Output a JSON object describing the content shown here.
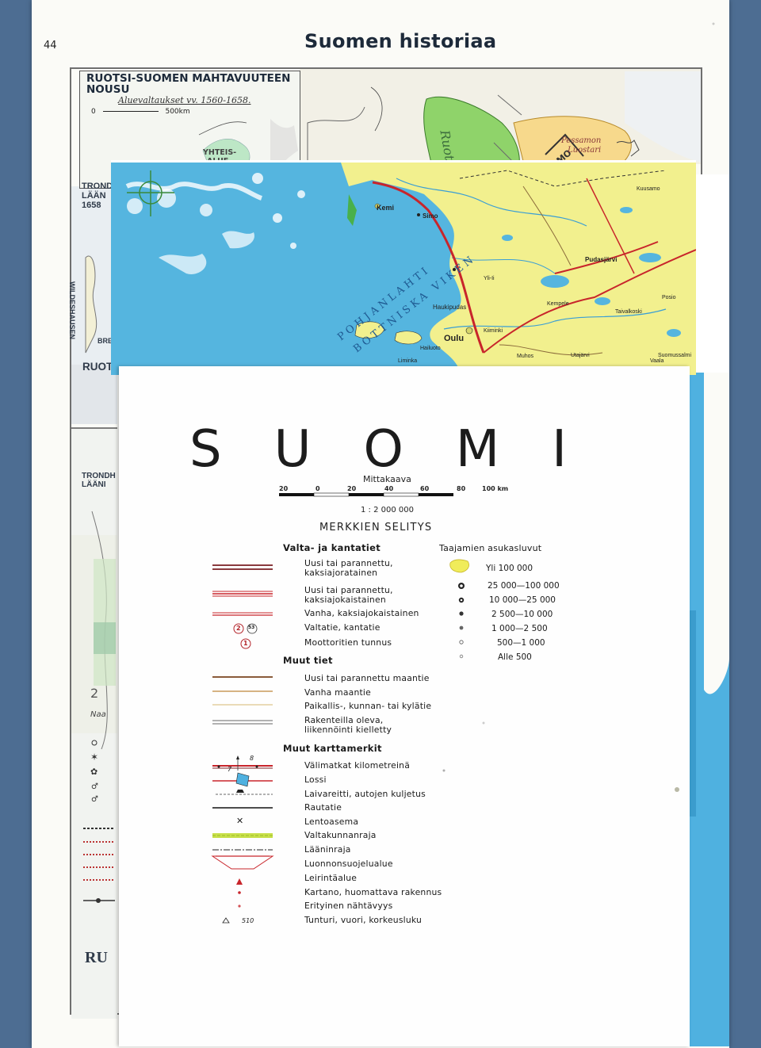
{
  "book_page": {
    "page_number": "44",
    "title": "Suomen historiaa"
  },
  "inset_map": {
    "title": "RUOTSI-SUOMEN MAHTAVUUTEEN NOUSU",
    "subtitle": "Aluevaltaukset vv. 1560-1658.",
    "scale_start": "0",
    "scale_end": "500km",
    "labels": [
      "YHTEIS-ALUE",
      "TRONDHJ LÄÄN 1658",
      "WILDESHAUSEN",
      "BREM",
      "RUOTS",
      "TRONDH LÄÄNI",
      "Pessamon Luostari",
      "RU"
    ]
  },
  "fold_map": {
    "sea_labels": [
      "POHJANLAHTI",
      "BOTTNISKA VIKEN"
    ],
    "places": [
      "Kemi",
      "Simo",
      "Ii",
      "Oulu",
      "Haukipudas",
      "Kiiminki",
      "Muhos",
      "Pudasjärvi",
      "Taivalkoski",
      "Posio",
      "Kuusamo",
      "Suomussalmi",
      "Hailuoto",
      "Liminka",
      "Kempele",
      "Yli-Ii",
      "Utajärvi",
      "Vaala"
    ]
  },
  "legend": {
    "map_title": "SUOMI",
    "scale_label": "Mittakaava",
    "scale_ticks": [
      "20",
      "0",
      "20",
      "40",
      "60",
      "80",
      "100 km"
    ],
    "ratio": "1 : 2 000 000",
    "heading": "MERKKIEN SELITYS",
    "section_roads": "Valta- ja kantatiet",
    "road_items": [
      "Uusi tai parannettu, kaksiajoratainen",
      "Uusi tai parannettu, kaksiajokaistainen",
      "Vanha, kaksiajokaistainen",
      "Valtatie, kantatie",
      "Moottoritien tunnus"
    ],
    "road_badges": [
      "2",
      "53",
      "1"
    ],
    "section_other_roads": "Muut tiet",
    "other_road_items": [
      "Uusi tai parannettu maantie",
      "Vanha maantie",
      "Paikallis-, kunnan- tai kylätie",
      "Rakenteilla oleva, liikennöinti kielletty"
    ],
    "section_other_marks": "Muut karttamerkit",
    "mark_items": [
      "Välimatkat kilometreinä",
      "Lossi",
      "Laivareitti, autojen kuljetus",
      "Rautatie",
      "Lentoasema",
      "Valtakunnanraja",
      "Lääninraja",
      "Luonnonsuojelualue",
      "Leirintäalue",
      "Kartano, huomattava rakennus",
      "Erityinen nähtävyys",
      "Tunturi, vuori, korkeusluku"
    ],
    "distance_marks": [
      "8",
      "7"
    ],
    "summit_label": "510",
    "population_heading": "Taajamien asukasluvut",
    "population_items": [
      "Yli 100 000",
      "25 000—100 000",
      "10 000—25 000",
      "2 500—10 000",
      "1 000—2 500",
      "500—1 000",
      "Alle 500"
    ]
  },
  "colors": {
    "sea": "#55b5df",
    "land": "#f3f1a0",
    "road_red": "#c8252b",
    "border_green": "#c8e04a",
    "page": "#fbfbf7",
    "cover": "#4d6d92"
  }
}
